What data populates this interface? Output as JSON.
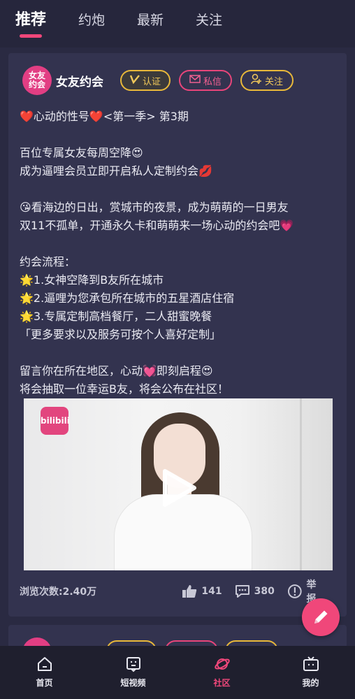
{
  "tabs": [
    {
      "label": "推荐",
      "active": true
    },
    {
      "label": "约炮",
      "active": false
    },
    {
      "label": "最新",
      "active": false
    },
    {
      "label": "关注",
      "active": false
    }
  ],
  "post": {
    "avatar_text_line1": "女友",
    "avatar_text_line2": "约会",
    "author": "女友约会",
    "verify_label": "认证",
    "message_label": "私信",
    "follow_label": "关注",
    "lines": [
      "❤️心动的性号❤️<第一季> 第3期",
      "",
      "百位专属女友每周空降😍",
      "成为逼哩会员立即开启私人定制约会💋",
      "",
      "😘看海边的日出，赏城市的夜景，成为萌萌的一日男友",
      "双11不孤单，开通永久卡和萌萌来一场心动的约会吧💗",
      "",
      "约会流程：",
      "🌟1.女神空降到B友所在城市",
      "🌟2.逼哩为您承包所在城市的五星酒店住宿",
      "🌟3.专属定制高档餐厅，二人甜蜜晚餐",
      "「更多要求以及服务可按个人喜好定制」",
      "",
      "留言你在所在地区，心动💓即刻启程😍",
      "将会抽取一位幸运B友，将会公布在社区！"
    ],
    "video_logo": "bilibili",
    "views": "浏览次数:2.40万",
    "likes": "141",
    "comments": "380",
    "report_label": "举报"
  },
  "bottom_nav": [
    {
      "label": "首页",
      "icon": "home-icon",
      "active": false
    },
    {
      "label": "短视频",
      "icon": "video-icon",
      "active": false
    },
    {
      "label": "社区",
      "icon": "planet-icon",
      "active": true
    },
    {
      "label": "我的",
      "icon": "tv-icon",
      "active": false
    }
  ],
  "colors": {
    "accent": "#f0477a",
    "gold": "#e8b83a",
    "background": "#2a2a42",
    "card": "#33334f"
  }
}
